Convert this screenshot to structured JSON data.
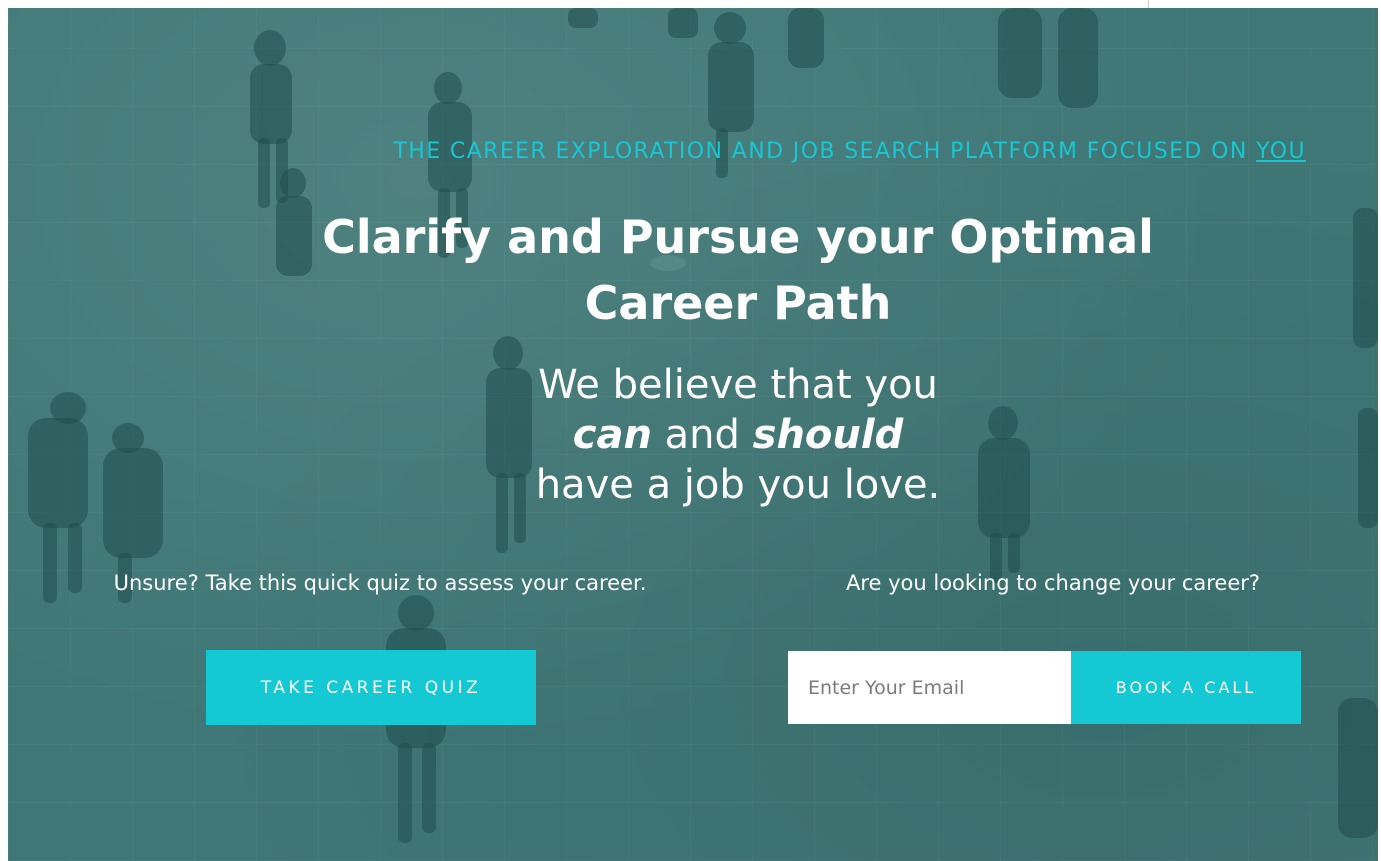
{
  "hero": {
    "tagline_text": "THE CAREER EXPLORATION AND JOB SEARCH PLATFORM FOCUSED ON ",
    "tagline_link": "YOU",
    "headline_line1": "Clarify and Pursue your Optimal",
    "headline_line2": "Career Path",
    "belief_line1": "We believe that you",
    "belief_can": "can",
    "belief_and": " and ",
    "belief_should": "should",
    "belief_line3": "have a job you love."
  },
  "quiz": {
    "prompt": "Unsure? Take this quick quiz to assess your career.",
    "button_label": "TAKE CAREER QUIZ"
  },
  "call": {
    "prompt": "Are you looking to change your career?",
    "email_placeholder": "Enter Your Email",
    "button_label": "BOOK A CALL"
  },
  "colors": {
    "overlay": "#3f7776",
    "accent": "#14c8d4",
    "text": "#ffffff"
  },
  "icons": {
    "background": "crowd-photo"
  }
}
